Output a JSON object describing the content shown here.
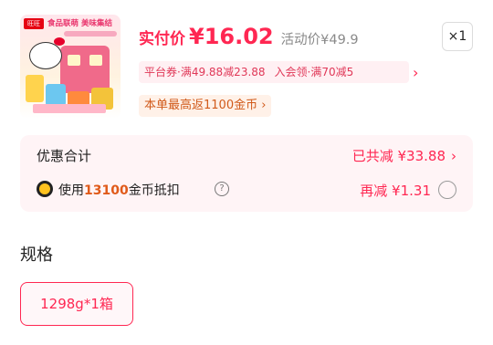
{
  "product": {
    "image": {
      "brand_mark": "旺旺",
      "collab_title": "食品联萌 美味集结"
    },
    "pay_price_label": "实付价",
    "pay_price": "¥16.02",
    "event_price": "活动价¥49.9",
    "quantity": "×1",
    "coupons": {
      "platform_prefix": "平台券·",
      "platform_text": "满49.88减23.88",
      "member_prefix": "入会领·",
      "member_text": "满70减5"
    },
    "cashback": "本单最高返1100金币"
  },
  "discount": {
    "label": "优惠合计",
    "total": "已共减 ¥33.88",
    "use_prefix": "使用",
    "coins": "13100",
    "use_suffix": "金币抵扣",
    "extra_minus": "再减 ¥1.31"
  },
  "spec": {
    "title": "规格",
    "option": "1298g*1箱"
  },
  "icons": {
    "coupon_arrow": "chevron-right-icon",
    "total_arrow": "chevron-right-icon",
    "coin": "coin-icon",
    "help": "question-circle-icon",
    "radio": "radio-unchecked-icon"
  },
  "colors": {
    "accent": "#ff2752",
    "panel_bg": "#fff4f6",
    "cashback_bg": "#fff1e8",
    "cashback_text": "#d15a1a"
  }
}
